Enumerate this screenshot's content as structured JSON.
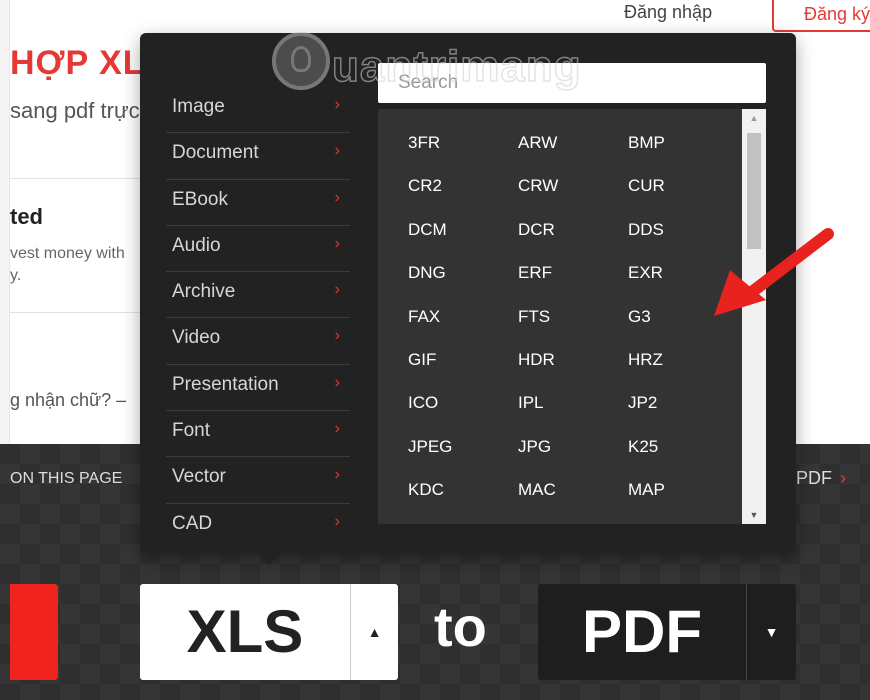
{
  "header": {
    "login_label": "Đăng nhập",
    "signup_label": "Đăng ký"
  },
  "background": {
    "heading": "HỢP XLS",
    "subtitle": "sang pdf trực",
    "card_title": "ted",
    "card_desc_line1": "vest money with",
    "card_desc_line2": "y.",
    "question": "g nhận chữ? –",
    "on_page": "ON THIS PAGE",
    "pdf_link": "PDF",
    "pdf_link_chevron": "›"
  },
  "converter": {
    "from_format": "XLS",
    "from_caret": "▲",
    "to_word": "to",
    "to_format": "PDF",
    "to_caret": "▼"
  },
  "dropdown": {
    "search_placeholder": "Search",
    "categories": [
      {
        "label": "Image",
        "chevron": "›"
      },
      {
        "label": "Document",
        "chevron": "›"
      },
      {
        "label": "EBook",
        "chevron": "›"
      },
      {
        "label": "Audio",
        "chevron": "›"
      },
      {
        "label": "Archive",
        "chevron": "›"
      },
      {
        "label": "Video",
        "chevron": "›"
      },
      {
        "label": "Presentation",
        "chevron": "›"
      },
      {
        "label": "Font",
        "chevron": "›"
      },
      {
        "label": "Vector",
        "chevron": "›"
      },
      {
        "label": "CAD",
        "chevron": "›"
      }
    ],
    "formats": [
      [
        "3FR",
        "ARW",
        "BMP"
      ],
      [
        "CR2",
        "CRW",
        "CUR"
      ],
      [
        "DCM",
        "DCR",
        "DDS"
      ],
      [
        "DNG",
        "ERF",
        "EXR"
      ],
      [
        "FAX",
        "FTS",
        "G3"
      ],
      [
        "GIF",
        "HDR",
        "HRZ"
      ],
      [
        "ICO",
        "IPL",
        "JP2"
      ],
      [
        "JPEG",
        "JPG",
        "K25"
      ],
      [
        "KDC",
        "MAC",
        "MAP"
      ]
    ],
    "scroll_up_glyph": "▲",
    "scroll_down_glyph": "▼"
  },
  "watermark": {
    "text": "uantrimang"
  },
  "colors": {
    "accent_red": "#e53935",
    "popup_bg": "#222222",
    "format_panel_bg": "#333333",
    "band_bg": "#2f2f2f"
  },
  "icons": {
    "category_chevron": "chevron-right-icon",
    "watermark_logo": "lightbulb-icon",
    "annotation": "arrow-icon"
  }
}
